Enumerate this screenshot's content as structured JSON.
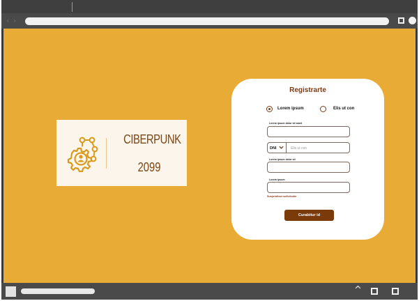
{
  "colors": {
    "background_accent": "#e8ab36",
    "brand_brown": "#7a3a14",
    "button_brown": "#7a3a0a",
    "logo_card_bg": "#fcf5ec",
    "chrome_dark": "#3f3f3f"
  },
  "browser": {
    "nav_icon": "back-forward-arrows-icon",
    "address_bar_value": "",
    "controls": [
      "square-icon",
      "circle-icon"
    ],
    "bottom_controls": [
      "chevron-up-icon",
      "square-icon",
      "square-icon"
    ]
  },
  "logo": {
    "icon": "gear-network-user-icon",
    "line1": "CIBERPUNK",
    "line2": "2099"
  },
  "form": {
    "title": "Registrarte",
    "radios": [
      {
        "label": "Lorem ipsum",
        "checked": true
      },
      {
        "label": "Elis ut con",
        "checked": false
      }
    ],
    "field1_label": "Lorem ipsum dolor sit amet",
    "field1_value": "",
    "id_type": "DNI",
    "id_placeholder": "Elis ut con",
    "field2_label": "Lorem ipsum dolor sit",
    "field2_value": "",
    "field3_label": "Lorem ipsum",
    "field3_value": "",
    "helper_text": "Suspendisse sollicitudin",
    "submit_label": "Curabitur id"
  }
}
